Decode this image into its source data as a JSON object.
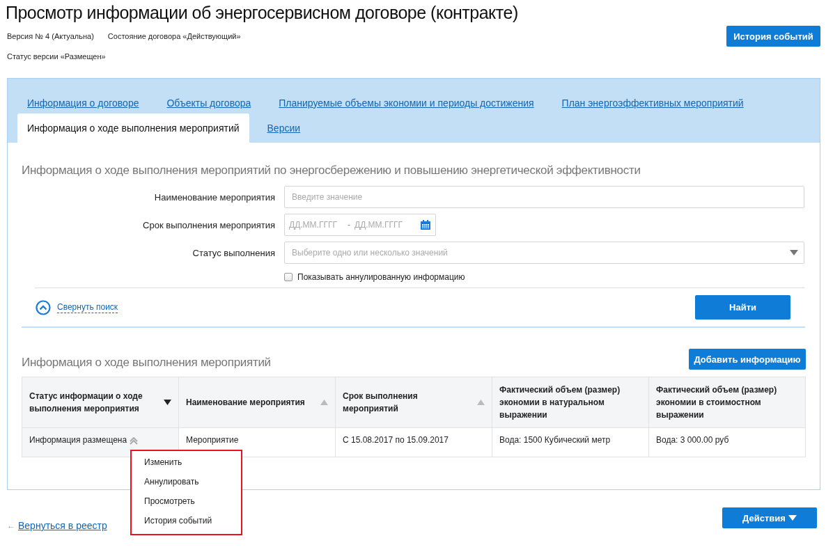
{
  "page": {
    "title": "Просмотр информации об энергосервисном договоре (контракте)",
    "version": "Версия № 4 (Актуальна)",
    "contract_state": "Состояние договора «Действующий»",
    "version_status": "Статус версии «Размещен»",
    "history_button": "История событий"
  },
  "tabs": [
    {
      "label": "Информация о договоре",
      "selected": false
    },
    {
      "label": "Объекты договора",
      "selected": false
    },
    {
      "label": "Планируемые объемы экономии и периоды достижения",
      "selected": false
    },
    {
      "label": "План энергоэффективных мероприятий",
      "selected": false
    },
    {
      "label": "Информация о ходе выполнения мероприятий",
      "selected": true
    },
    {
      "label": "Версии",
      "selected": false
    }
  ],
  "search": {
    "title": "Информация о ходе выполнения мероприятий по энергосбережению и повышению энергетической эффективности",
    "fields": [
      {
        "kind": "text",
        "label": "Наименование мероприятия",
        "placeholder": "Введите значение"
      },
      {
        "kind": "daterange",
        "label": "Срок выполнения мероприятия",
        "placeholder": "ДД.ММ.ГГГГ",
        "separator": "-",
        "placeholder_to": "ДД.ММ.ГГГГ"
      },
      {
        "kind": "select",
        "label": "Статус выполнения",
        "placeholder": "Выберите одно или несколько значений"
      }
    ],
    "show_cancelled": {
      "label": "Показывать аннулированную информацию",
      "checked": false
    },
    "collapse_link": "Свернуть поиск",
    "find_button": "Найти"
  },
  "results": {
    "title": "Информация о ходе выполнения мероприятий",
    "add_button": "Добавить информацию",
    "columns": [
      {
        "label": "Статус информации о ходе выполнения мероприятия",
        "sort_active": true,
        "sort_descending": true
      },
      {
        "label": "Наименование мероприятия",
        "sort_active": false,
        "sort_descending": false
      },
      {
        "label": "Срок выполнения мероприятий",
        "sort_active": false,
        "sort_descending": false
      },
      {
        "label": "Фактический объем (размер) экономии в натуральном выражении"
      },
      {
        "label": "Фактический объем (размер) экономии в стоимостном выражении"
      }
    ],
    "rows": [
      {
        "cells": [
          "Информация размещена",
          "Мероприятие",
          "С 15.08.2017 по 15.09.2017",
          "Вода: 1500 Кубический метр",
          "Вода: 3 000.00 руб"
        ],
        "menu_open": true
      }
    ],
    "row_menu": [
      "Изменить",
      "Аннулировать",
      "Просмотреть",
      "История событий"
    ]
  },
  "footer": {
    "back_link": "Вернуться в реестр",
    "back_arrow": "←",
    "actions_button": "Действия"
  }
}
